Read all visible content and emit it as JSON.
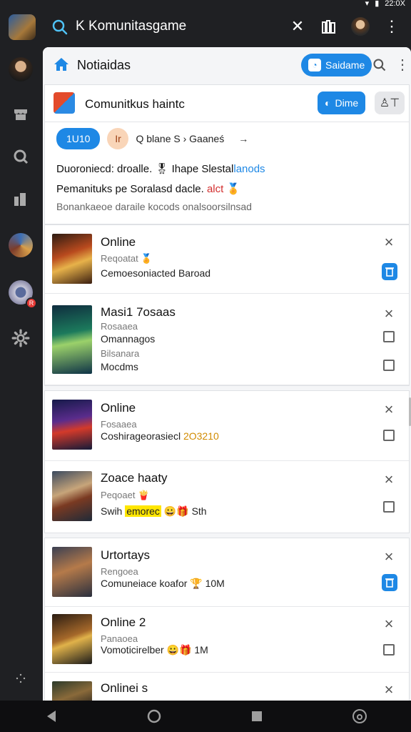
{
  "status": {
    "time": "22:0X"
  },
  "search": {
    "text": "K Komunitasgame"
  },
  "panel": {
    "title": "Notiaidas",
    "primary_button": "Saidame"
  },
  "community": {
    "title": "Comunitkus haintc",
    "join_button": "Dime",
    "chip_label": "1U10",
    "chip_icon_text": "Ir",
    "chip_text": "Q blane  S › Gaaneś",
    "line1_prefix": "Duoroniecd: droalle. 🎖 Ihape Slestal",
    "line1_link": "lanods",
    "line2_prefix": "Pemanituks pe Soralasd dacle. ",
    "line2_emph": "alct",
    "line2_emoji": "🏅",
    "line3": "Bonankaeoe daraile kocods onalsoorsilnsad"
  },
  "cards": [
    {
      "title": "Online",
      "sub": "Reqoatat 🏅",
      "desc": "Cemoesoniacted Baroad",
      "action": "trash"
    },
    {
      "title": "Masi1 7osaas",
      "sub": "Rosaaea",
      "desc": "Omannagos",
      "extra_sub": "Bilsanara",
      "extra_desc": "Mocdms",
      "action": "checkbox"
    },
    {
      "title": "Online",
      "sub": "Fosaaea",
      "desc_prefix": "Coshirageorasiecl ",
      "desc_orange": "2O3210",
      "action": "checkbox"
    },
    {
      "title": "Zoace haaty",
      "sub": "Peqoaet 🍟",
      "desc_prefix": "Swih ",
      "desc_hl": "emorec",
      "desc_suffix": "  😀🎁 Sth",
      "action": "checkbox"
    },
    {
      "title": "Urtortays",
      "sub": "Rengoea",
      "desc": "Comuneiace koafor 🏆 10M",
      "action": "trash"
    },
    {
      "title": "Online 2",
      "sub": "Panaoea",
      "desc": "Vomoticirelber 😀🎁 1M",
      "action": "checkbox"
    },
    {
      "title": "Onlinei s",
      "action": "none"
    }
  ],
  "colors": {
    "accent": "#1e88e5",
    "dark": "#1f2023",
    "panel": "#f4f5f7"
  }
}
